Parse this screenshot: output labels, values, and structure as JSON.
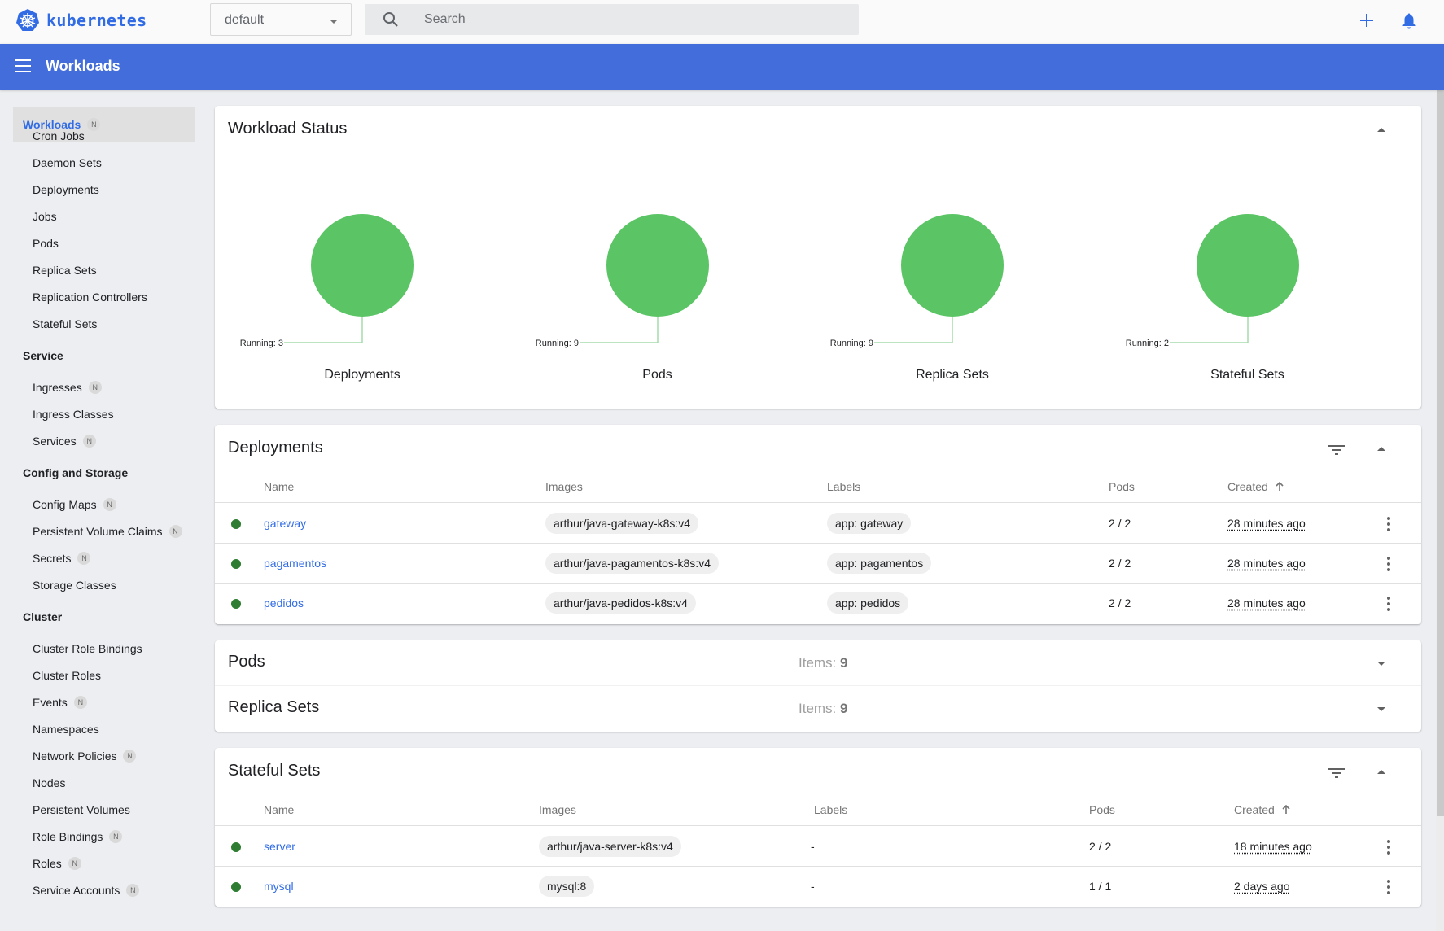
{
  "app": {
    "brand": "kubernetes",
    "namespace_selected": "default",
    "search_placeholder": "Search",
    "page_title": "Workloads",
    "colors": {
      "brand": "#326ce5",
      "appbar": "#426ddb",
      "running": "#5bc565",
      "status_ok": "#2e7d32"
    }
  },
  "toolbar": {
    "create_icon": "plus-icon",
    "notifications_icon": "bell-icon"
  },
  "sidebar": {
    "active": {
      "label": "Workloads",
      "badge": "N"
    },
    "workloads_items": [
      {
        "label": "Cron Jobs"
      },
      {
        "label": "Daemon Sets"
      },
      {
        "label": "Deployments"
      },
      {
        "label": "Jobs"
      },
      {
        "label": "Pods"
      },
      {
        "label": "Replica Sets"
      },
      {
        "label": "Replication Controllers"
      },
      {
        "label": "Stateful Sets"
      }
    ],
    "groups": [
      {
        "label": "Service",
        "items": [
          {
            "label": "Ingresses",
            "badge": "N"
          },
          {
            "label": "Ingress Classes"
          },
          {
            "label": "Services",
            "badge": "N"
          }
        ]
      },
      {
        "label": "Config and Storage",
        "items": [
          {
            "label": "Config Maps",
            "badge": "N"
          },
          {
            "label": "Persistent Volume Claims",
            "badge": "N"
          },
          {
            "label": "Secrets",
            "badge": "N"
          },
          {
            "label": "Storage Classes"
          }
        ]
      },
      {
        "label": "Cluster",
        "items": [
          {
            "label": "Cluster Role Bindings"
          },
          {
            "label": "Cluster Roles"
          },
          {
            "label": "Events",
            "badge": "N"
          },
          {
            "label": "Namespaces"
          },
          {
            "label": "Network Policies",
            "badge": "N"
          },
          {
            "label": "Nodes"
          },
          {
            "label": "Persistent Volumes"
          },
          {
            "label": "Role Bindings",
            "badge": "N"
          },
          {
            "label": "Roles",
            "badge": "N"
          },
          {
            "label": "Service Accounts",
            "badge": "N"
          }
        ]
      }
    ]
  },
  "workload_status": {
    "title": "Workload Status",
    "charts": [
      {
        "label": "Deployments",
        "running_label": "Running: 3",
        "running": 3
      },
      {
        "label": "Pods",
        "running_label": "Running: 9",
        "running": 9
      },
      {
        "label": "Replica Sets",
        "running_label": "Running: 9",
        "running": 9
      },
      {
        "label": "Stateful Sets",
        "running_label": "Running: 2",
        "running": 2
      }
    ]
  },
  "chart_data": {
    "type": "pie",
    "title": "Workload Status",
    "charts": [
      {
        "title": "Deployments",
        "slices": [
          {
            "name": "Running",
            "value": 3,
            "color": "#5bc565"
          }
        ]
      },
      {
        "title": "Pods",
        "slices": [
          {
            "name": "Running",
            "value": 9,
            "color": "#5bc565"
          }
        ]
      },
      {
        "title": "Replica Sets",
        "slices": [
          {
            "name": "Running",
            "value": 9,
            "color": "#5bc565"
          }
        ]
      },
      {
        "title": "Stateful Sets",
        "slices": [
          {
            "name": "Running",
            "value": 2,
            "color": "#5bc565"
          }
        ]
      }
    ]
  },
  "deployments": {
    "title": "Deployments",
    "columns": {
      "name": "Name",
      "images": "Images",
      "labels": "Labels",
      "pods": "Pods",
      "created": "Created",
      "sort_icon": "arrow-up-icon"
    },
    "rows": [
      {
        "name": "gateway",
        "image": "arthur/java-gateway-k8s:v4",
        "label": "app: gateway",
        "pods": "2 / 2",
        "created": "28 minutes ago"
      },
      {
        "name": "pagamentos",
        "image": "arthur/java-pagamentos-k8s:v4",
        "label": "app: pagamentos",
        "pods": "2 / 2",
        "created": "28 minutes ago"
      },
      {
        "name": "pedidos",
        "image": "arthur/java-pedidos-k8s:v4",
        "label": "app: pedidos",
        "pods": "2 / 2",
        "created": "28 minutes ago"
      }
    ]
  },
  "collapsed": [
    {
      "title": "Pods",
      "items_label": "Items:",
      "items_count": "9"
    },
    {
      "title": "Replica Sets",
      "items_label": "Items:",
      "items_count": "9"
    }
  ],
  "stateful_sets": {
    "title": "Stateful Sets",
    "columns": {
      "name": "Name",
      "images": "Images",
      "labels": "Labels",
      "pods": "Pods",
      "created": "Created"
    },
    "rows": [
      {
        "name": "server",
        "image": "arthur/java-server-k8s:v4",
        "label": "-",
        "pods": "2 / 2",
        "created": "18 minutes ago"
      },
      {
        "name": "mysql",
        "image": "mysql:8",
        "label": "-",
        "pods": "1 / 1",
        "created": "2 days ago"
      }
    ]
  }
}
